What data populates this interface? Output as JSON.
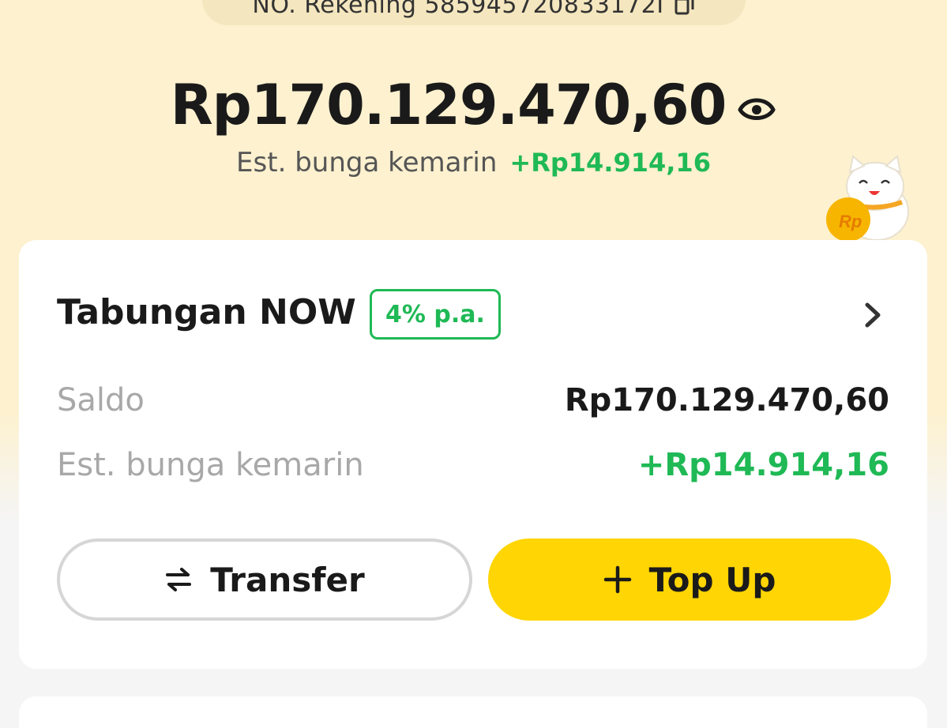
{
  "account": {
    "number_text": "NO. Rekening 585945720833172I",
    "copy_icon": "copy-icon"
  },
  "summary": {
    "balance": "Rp170.129.470,60",
    "eye_icon": "eye-icon",
    "interest_label": "Est. bunga kemarin",
    "interest_value": "+Rp14.914,16"
  },
  "mascot": {
    "coin_text": "Rp"
  },
  "card": {
    "title": "Tabungan NOW",
    "rate_badge": "4% p.a.",
    "chevron_icon": "chevron-right-icon",
    "saldo_label": "Saldo",
    "saldo_value": "Rp170.129.470,60",
    "bunga_label": "Est. bunga kemarin",
    "bunga_value": "+Rp14.914,16",
    "transfer_label": "Transfer",
    "topup_label": "Top Up"
  },
  "colors": {
    "background_top": "#fdf1cf",
    "accent_yellow": "#ffd503",
    "positive_green": "#1fb955",
    "muted_gray": "#a8a8a8"
  }
}
